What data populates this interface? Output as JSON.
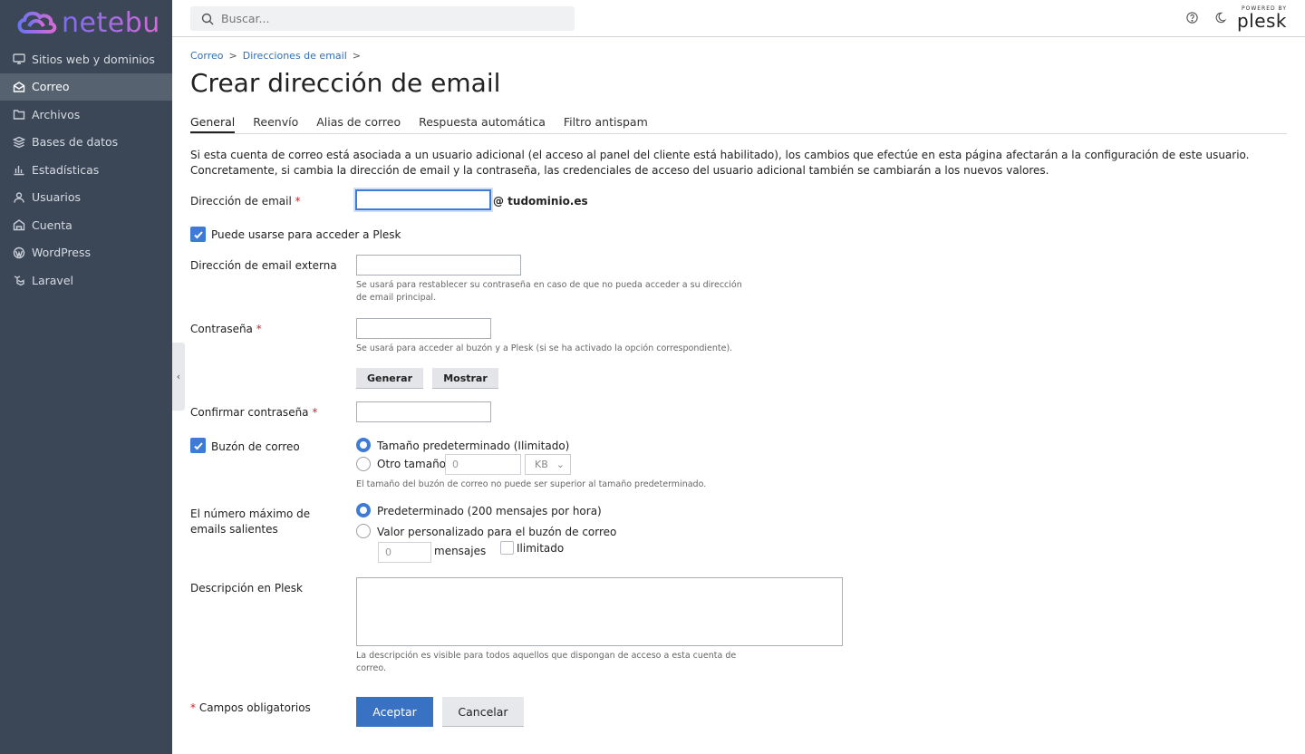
{
  "sidebar": {
    "brand": "netebu",
    "items": [
      {
        "label": "Sitios web y dominios",
        "icon": "monitor-icon"
      },
      {
        "label": "Correo",
        "icon": "envelope-icon"
      },
      {
        "label": "Archivos",
        "icon": "folder-icon"
      },
      {
        "label": "Bases de datos",
        "icon": "layers-icon"
      },
      {
        "label": "Estadísticas",
        "icon": "bar-chart-icon"
      },
      {
        "label": "Usuarios",
        "icon": "user-icon"
      },
      {
        "label": "Cuenta",
        "icon": "account-icon"
      },
      {
        "label": "WordPress",
        "icon": "wordpress-icon"
      },
      {
        "label": "Laravel",
        "icon": "laravel-icon"
      }
    ],
    "active_index": 1
  },
  "header": {
    "search_placeholder": "Buscar...",
    "powered_by": "POWERED BY",
    "plesk": "plesk"
  },
  "breadcrumb": {
    "items": [
      "Correo",
      "Direcciones de email"
    ],
    "separator": ">"
  },
  "page": {
    "title": "Crear dirección de email",
    "tabs": [
      "General",
      "Reenvío",
      "Alias de correo",
      "Respuesta automática",
      "Filtro antispam"
    ],
    "intro": "Si esta cuenta de correo está asociada a un usuario adicional (el acceso al panel del cliente está habilitado), los cambios que efectúe en esta página afectarán a la configuración de este usuario. Concretamente, si cambia la dirección de email y la contraseña, las credenciales de acceso del usuario adicional también se cambiarán a los nuevos valores."
  },
  "form": {
    "email_label": "Dirección de email",
    "email_value": "",
    "domain_suffix": "@ tudominio.es",
    "plesk_access_label": "Puede usarse para acceder a Plesk",
    "plesk_access_checked": true,
    "external_email_label": "Dirección de email externa",
    "external_email_value": "",
    "external_email_hint": "Se usará para restablecer su contraseña en caso de que no pueda acceder a su dirección de email principal.",
    "password_label": "Contraseña",
    "password_hint": "Se usará para acceder al buzón y a Plesk (si se ha activado la opción correspondiente).",
    "generate_label": "Generar",
    "show_label": "Mostrar",
    "confirm_password_label": "Confirmar contraseña",
    "mailbox_label": "Buzón de correo",
    "mailbox_checked": true,
    "mailbox_default_option": "Tamaño predeterminado (Ilimitado)",
    "mailbox_other_option": "Otro tamaño",
    "mailbox_size_value": "0",
    "mailbox_unit": "KB",
    "mailbox_hint": "El tamaño del buzón de correo no puede ser superior al tamaño predeterminado.",
    "max_emails_label": "El número máximo de emails salientes",
    "max_emails_default_option": "Predeterminado (200 mensajes por hora)",
    "max_emails_custom_option": "Valor personalizado para el buzón de correo",
    "max_emails_value": "0",
    "max_emails_unit": "mensajes",
    "unlimited_label": "Ilimitado",
    "description_label": "Descripción en Plesk",
    "description_value": "",
    "description_hint": "La descripción es visible para todos aquellos que dispongan de acceso a esta cuenta de correo.",
    "required_star": "*",
    "required_note": "Campos obligatorios",
    "accept_label": "Aceptar",
    "cancel_label": "Cancelar"
  },
  "colors": {
    "sidebar_bg": "#3b4656",
    "accent": "#3a72c3",
    "required": "#d2232a"
  }
}
